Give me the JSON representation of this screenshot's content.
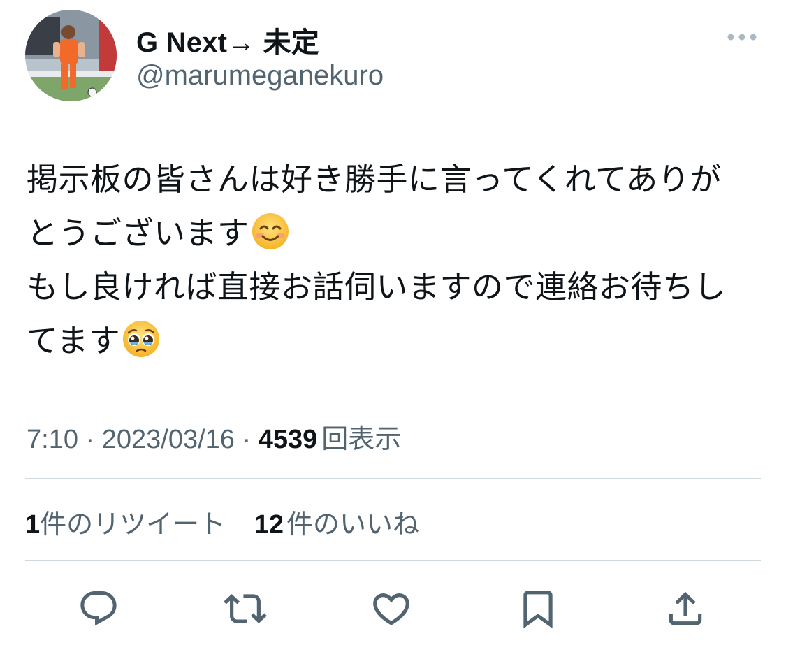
{
  "user": {
    "display_name": "G Next→ 未定",
    "handle": "@marumeganekuro",
    "avatar": "avatar-photo"
  },
  "tweet": {
    "lines": [
      {
        "text": "掲示板の皆さんは好き勝手に言ってくれてありが",
        "emoji": ""
      },
      {
        "text": "とうございます",
        "emoji": "smiling-face-emoji"
      },
      {
        "text": "もし良ければ直接お話伺いますので連絡お待ちし",
        "emoji": ""
      },
      {
        "text": "てます",
        "emoji": "pleading-face-emoji"
      }
    ]
  },
  "meta": {
    "time": "7:10",
    "separator": " · ",
    "date": "2023/03/16",
    "views_count": "4539",
    "views_label": "回表示"
  },
  "stats": {
    "retweets_count": "1",
    "retweets_label": "件のリツイート",
    "likes_count": "12",
    "likes_label": "件のいいね"
  },
  "actions": [
    {
      "name": "reply",
      "icon": "reply-icon"
    },
    {
      "name": "retweet",
      "icon": "retweet-icon"
    },
    {
      "name": "like",
      "icon": "heart-icon"
    },
    {
      "name": "bookmark",
      "icon": "bookmark-icon"
    },
    {
      "name": "share",
      "icon": "share-icon"
    }
  ],
  "colors": {
    "text_primary": "#0f1419",
    "text_secondary": "#536471",
    "divider": "#cfd9de",
    "icon": "#536471"
  }
}
